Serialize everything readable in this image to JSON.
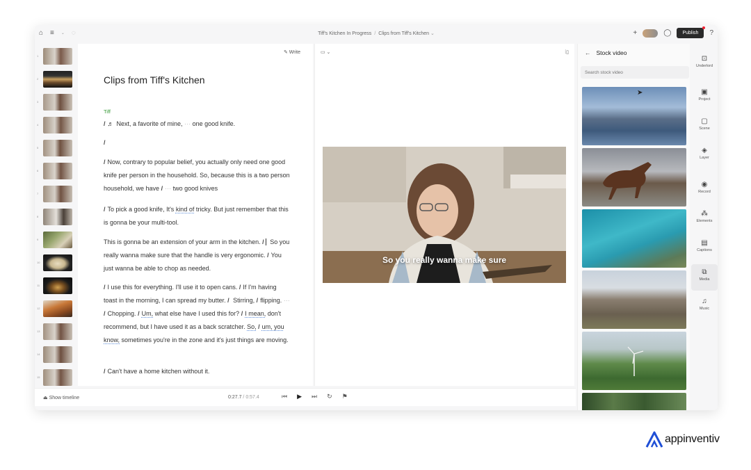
{
  "window": {
    "breadcrumb": [
      "Tiff's Kitchen In Progress",
      "Clips from Tiff's Kitchen"
    ],
    "publish_label": "Publish",
    "add_collaborator": "+"
  },
  "thumbnails": {
    "numbers": [
      "1",
      "2",
      "3",
      "4",
      "5",
      "6",
      "7",
      "8",
      "9",
      "10",
      "11",
      "12",
      "13",
      "14",
      "15"
    ]
  },
  "editor": {
    "write_label": "Write",
    "doc_title": "Clips from Tiff's Kitchen",
    "speaker": "Tiff",
    "paragraphs": [
      {
        "segments": [
          "Next, a favorite of mine,",
          "one good knife."
        ]
      },
      {
        "segments": [
          ""
        ]
      },
      {
        "segments": [
          "Now, contrary to popular belief, you actually only need one good knife per person in the household. So, because this is a two person household, we have",
          "two good knives"
        ]
      },
      {
        "segments": [
          "To pick a good knife, It's",
          "kind of",
          "tricky. But just remember that this is gonna be your multi-tool."
        ]
      },
      {
        "segments": [
          "This is gonna be",
          "an extension of your arm in the kitchen.",
          "So you really wanna make sure that the handle is very ergonomic.",
          "You just wanna be able to chop as needed."
        ]
      },
      {
        "segments": [
          "I use this for everything.",
          "I'll use it to open cans.",
          "If I'm having toast in the morning, I can spread my butter.",
          "Stirring,",
          "flipping.",
          "Chopping.",
          "Um,",
          "what else have I used this for?",
          "I mean,",
          "don't recommend, but I have used it as a back scratcher.",
          "So,",
          "um, you know,",
          "sometimes you're in the zone and it's just things are moving."
        ]
      },
      {
        "segments": [
          "Can't have a home kitchen without it."
        ]
      }
    ]
  },
  "preview": {
    "caption": "So you really wanna make sure"
  },
  "bottombar": {
    "show_timeline": "Show timeline",
    "current_time": "0:27.7",
    "total_time": "0:57.4"
  },
  "stock_panel": {
    "title": "Stock video",
    "search_placeholder": "Search stock video",
    "tiles": [
      "lake-mountains",
      "horse-running",
      "turquoise-coast",
      "stone-ruins",
      "wind-turbine-field",
      "forest"
    ]
  },
  "rail": {
    "items": [
      {
        "label": "Underlord",
        "icon": "robot-icon"
      },
      {
        "label": "Project",
        "icon": "project-icon"
      },
      {
        "label": "Scene",
        "icon": "scene-icon"
      },
      {
        "label": "Layer",
        "icon": "layer-icon"
      },
      {
        "label": "Record",
        "icon": "record-icon"
      },
      {
        "label": "Elements",
        "icon": "elements-icon"
      },
      {
        "label": "Captions",
        "icon": "captions-icon"
      },
      {
        "label": "Media",
        "icon": "media-icon"
      },
      {
        "label": "Music",
        "icon": "music-icon"
      }
    ],
    "active": "Media"
  },
  "branding": {
    "logo_text": "appinventiv",
    "accent": "#1f4fd6"
  }
}
